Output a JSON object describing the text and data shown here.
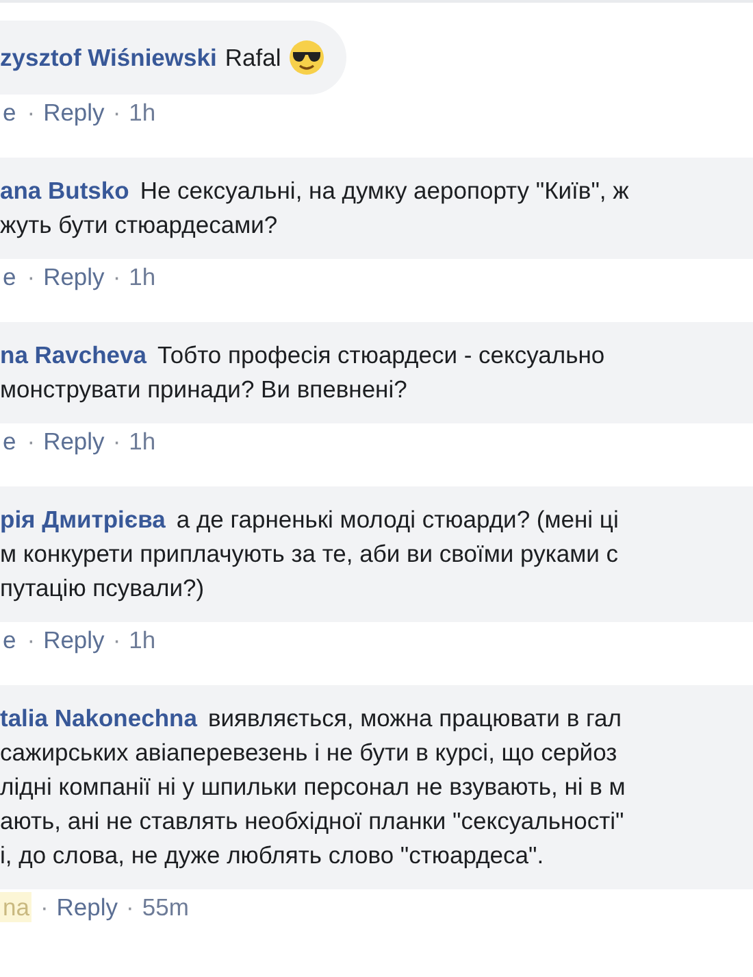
{
  "comments": [
    {
      "author": "zysztof Wiśniewski",
      "lines": [
        "Rafal"
      ],
      "emoji": true,
      "actions": {
        "like": "e",
        "like_highlighted": false,
        "separator_1": "·",
        "reply": "Reply",
        "separator_2": "·",
        "time": "1h"
      }
    },
    {
      "author": "ana Butsko",
      "lines": [
        "Не сексуальні, на думку аеропорту \"Київ\", ж",
        "жуть бути стюардесами?"
      ],
      "emoji": false,
      "actions": {
        "like": "e",
        "like_highlighted": false,
        "separator_1": "·",
        "reply": "Reply",
        "separator_2": "·",
        "time": "1h"
      }
    },
    {
      "author": "na Ravcheva",
      "lines": [
        "Тобто професія стюардеси - сексуально",
        "монструвати принади? Ви впевнені?"
      ],
      "emoji": false,
      "actions": {
        "like": "e",
        "like_highlighted": false,
        "separator_1": "·",
        "reply": "Reply",
        "separator_2": "·",
        "time": "1h"
      }
    },
    {
      "author": "рія Дмитрієва",
      "lines": [
        "а де гарненькі молоді стюарди? (мені ці",
        "м конкурети приплачують за те, аби ви своїми руками с",
        "путацію псували?)"
      ],
      "emoji": false,
      "actions": {
        "like": "e",
        "like_highlighted": false,
        "separator_1": "·",
        "reply": "Reply",
        "separator_2": "·",
        "time": "1h"
      }
    },
    {
      "author": "talia Nakonechna",
      "lines": [
        "виявляється, можна працювати в гал",
        "сажирських авіаперевезень і не бути в курсі, що серйоз",
        "лідні компанії ні у шпильки персонал не взувають, ні в м",
        "ають, ані не ставлять необхідної планки \"сексуальності\"",
        "і, до слова, не дуже люблять слово \"стюардеса\"."
      ],
      "emoji": false,
      "actions": {
        "like": "na",
        "like_highlighted": true,
        "separator_1": "·",
        "reply": "Reply",
        "separator_2": "·",
        "time": "55m"
      }
    }
  ]
}
